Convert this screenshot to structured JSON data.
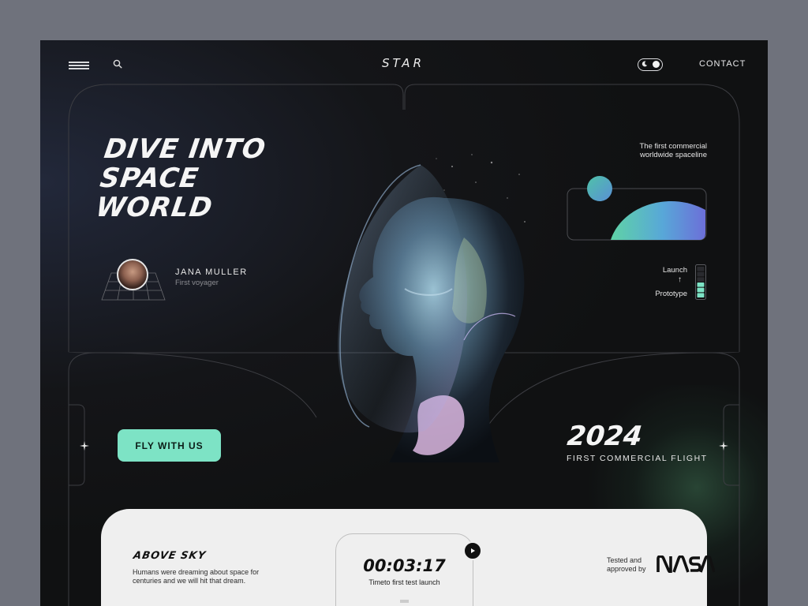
{
  "nav": {
    "logo_text": "STAR",
    "contact_label": "CONTACT"
  },
  "hero": {
    "title_line1": "DIVE INTO",
    "title_line2": "SPACE",
    "title_line3": "WORLD"
  },
  "voyager": {
    "name": "JANA MULLER",
    "role": "First voyager"
  },
  "info": {
    "tagline_line1": "The first commercial",
    "tagline_line2": "worldwide spaceline",
    "stage_top": "Launch",
    "stage_arrow": "↑",
    "stage_bottom": "Prototype",
    "progress_filled_segments": 3,
    "progress_total_segments": 6
  },
  "cta": {
    "button_label": "FLY WITH US"
  },
  "flight": {
    "year": "2024",
    "caption": "FIRST COMMERCIAL FLIGHT"
  },
  "bottom": {
    "above_title": "ABOVE SKY",
    "above_text": "Humans were dreaming about space for centuries and we will hit that dream.",
    "timer": "00:03:17",
    "timer_caption": "Timeto first test launch",
    "tested_text": "Tested and approved by",
    "partner_logo_text": "NASA"
  },
  "colors": {
    "accent": "#7de3c5",
    "background": "#111214",
    "panel": "#efefef"
  },
  "icons": [
    "menu-icon",
    "search-icon",
    "moon-icon",
    "sparkle-icon",
    "play-icon",
    "battery-icon"
  ]
}
